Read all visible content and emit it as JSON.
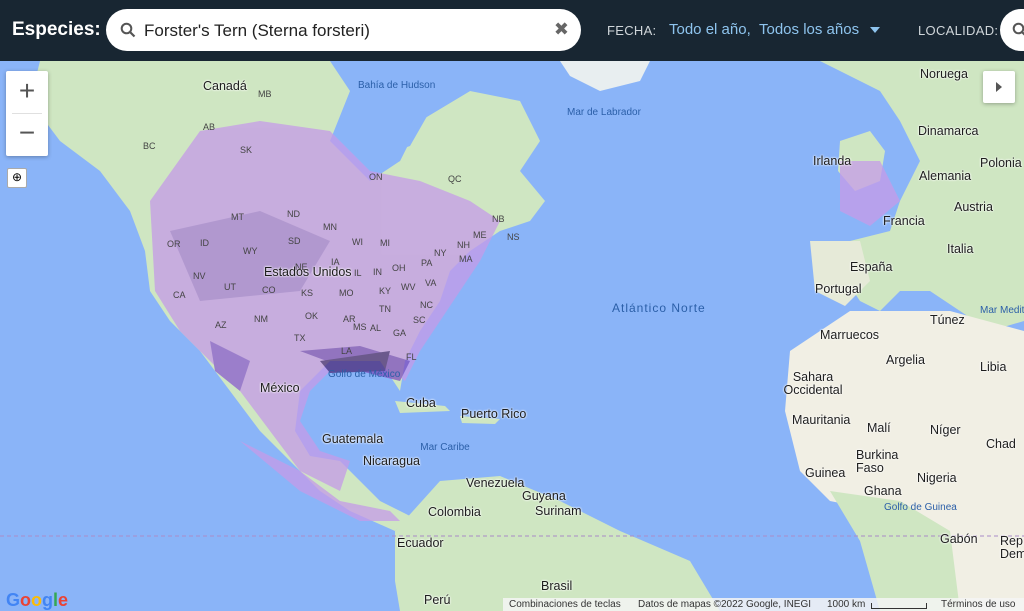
{
  "header": {
    "species_label": "Especies:",
    "species_value": "Forster's Tern (Sterna forsteri)",
    "date_label": "FECHA:",
    "date_range": "Todo el año,",
    "year_range": "Todos los años",
    "location_label": "LOCALIDAD:"
  },
  "map": {
    "countries": [
      "Canadá",
      "Estados Unidos",
      "México",
      "Cuba",
      "Guatemala",
      "Nicaragua",
      "Venezuela",
      "Colombia",
      "Guyana",
      "Surinam",
      "Ecuador",
      "Brasil",
      "Perú",
      "Noruega",
      "Dinamarca",
      "Irlanda",
      "Polonia",
      "Alemania",
      "Austria",
      "Francia",
      "Italia",
      "España",
      "Portugal",
      "Túnez",
      "Marruecos",
      "Argelia",
      "Libia",
      "Sahara Occidental",
      "Mauritania",
      "Malí",
      "Níger",
      "Chad",
      "Burkina Faso",
      "Guinea",
      "Ghana",
      "Nigeria",
      "Gabón",
      "Rep. Demo",
      "Puerto Rico",
      "Mar Mediterráneo"
    ],
    "states": [
      "MB",
      "BC",
      "AB",
      "SK",
      "ON",
      "QC",
      "NS",
      "NB",
      "ME",
      "NH",
      "NY",
      "MA",
      "MT",
      "ND",
      "SD",
      "MN",
      "WI",
      "MI",
      "WY",
      "ID",
      "OR",
      "NV",
      "CA",
      "UT",
      "CO",
      "NE",
      "IA",
      "IL",
      "IN",
      "OH",
      "PA",
      "MO",
      "KS",
      "OK",
      "KY",
      "VA",
      "WV",
      "NC",
      "TN",
      "AR",
      "AZ",
      "NM",
      "TX",
      "LA",
      "MS",
      "AL",
      "GA",
      "SC",
      "FL"
    ],
    "waters": {
      "hudson": "Bahía de Hudson",
      "labrador": "Mar de Labrador",
      "atlantic": "Atlántico Norte",
      "gulf_mexico": "Golfo de México",
      "caribbean": "Mar Caribe",
      "gulf_guinea": "Golfo de Guinea"
    },
    "google_logo": "Google",
    "footer": {
      "shortcuts": "Combinaciones de teclas",
      "data": "Datos de mapas ©2022 Google, INEGI",
      "scale": "1000 km",
      "terms": "Términos de uso"
    },
    "colors": {
      "land": "#cfe6c2",
      "water": "#8ab4f8",
      "range": "#b98be0",
      "range_dark": "#6b3fa0"
    }
  }
}
